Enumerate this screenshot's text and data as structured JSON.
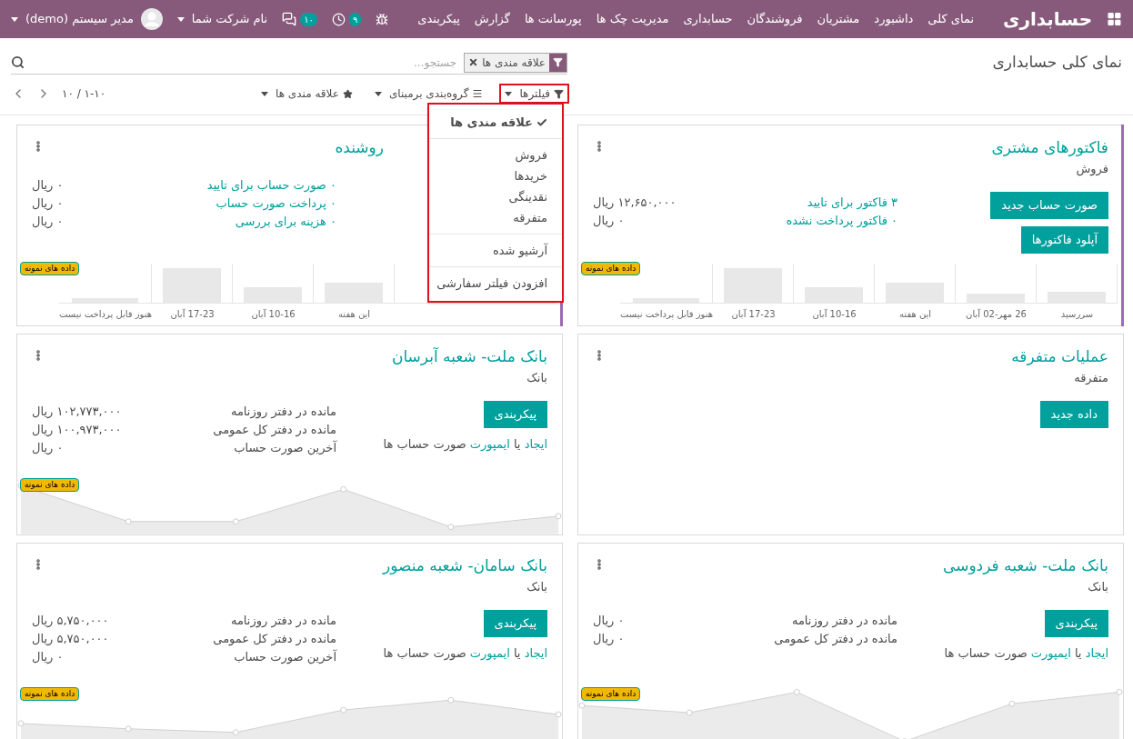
{
  "navbar": {
    "brand": "حسابداری",
    "menu": [
      "نمای کلی",
      "داشبورد",
      "مشتریان",
      "فروشندگان",
      "حسابداری",
      "مدیریت چک ها",
      "پورسانت ها",
      "گزارش",
      "پیکربندی"
    ],
    "activity_count": "۹",
    "message_count": "۱۰",
    "company": "نام شرکت شما",
    "user": "مدیر سیستم (demo)"
  },
  "control_panel": {
    "breadcrumb": "نمای کلی حسابداری",
    "search": {
      "facet": "علاقه مندی ها",
      "placeholder": "جستجو..."
    },
    "filter_buttons": [
      {
        "label": "فیلترها",
        "kind": "filter",
        "highlighted": true
      },
      {
        "label": "گروه‌بندی برمبنای",
        "kind": "group",
        "highlighted": false
      },
      {
        "label": "علاقه مندی ها",
        "kind": "favorite",
        "highlighted": false
      }
    ],
    "pager": "۱-۱۰ / ۱۰"
  },
  "filter_menu": {
    "highlighted": true,
    "groups": [
      [
        {
          "label": "علاقه مندی ها",
          "checked": true
        }
      ],
      [
        {
          "label": "فروش",
          "checked": false
        },
        {
          "label": "خریدها",
          "checked": false
        },
        {
          "label": "نقدینگی",
          "checked": false
        },
        {
          "label": "متفرقه",
          "checked": false
        }
      ],
      [
        {
          "label": "آرشیو شده",
          "checked": false
        }
      ],
      [
        {
          "label": "افزودن فیلتر سفارشی",
          "checked": false
        }
      ]
    ]
  },
  "cards": [
    {
      "title": "فاکتورهای مشتری",
      "subtitle": "فروش",
      "covered": false,
      "color": "#9b6bb5",
      "buttons": [
        "صورت حساب جدید",
        "آپلود فاکتورها"
      ],
      "stats": [
        {
          "kind": "link",
          "label": "۳ فاکتور برای تایید",
          "value": "۱۲,۶۵۰,۰۰۰ ریال"
        },
        {
          "kind": "link",
          "label": "۰ فاکتور پرداخت نشده",
          "value": "۰ ریال"
        }
      ],
      "badge": "داده های نمونه",
      "graph": {
        "kind": "bar",
        "labels": [
          "سررسید",
          "26 مهر-02 آبان",
          "این هفته",
          "10-16 آبان",
          "17-23 آبان",
          "هنوز قابل پرداخت نیست"
        ]
      }
    },
    {
      "title": "روشنده",
      "covered": true,
      "color": "#9b6bb5",
      "stats": [
        {
          "kind": "link",
          "label": "۰ صورت حساب برای تایید",
          "value": "۰ ریال"
        },
        {
          "kind": "link",
          "label": "۰ پرداخت صورت حساب",
          "value": "۰ ریال"
        },
        {
          "kind": "link",
          "label": "۰ هزینه برای بررسی",
          "value": "۰ ریال"
        }
      ],
      "badge": "داده های نمونه",
      "graph": {
        "kind": "bar",
        "labels": [
          "این هفته",
          "10-16 آبان",
          "17-23 آبان",
          "هنوز قابل پرداخت نیست"
        ]
      }
    },
    {
      "title": "عملیات متفرقه",
      "subtitle": "متفرقه",
      "covered": false,
      "buttons": [
        "داده جدید"
      ]
    },
    {
      "title": "بانک ملت- شعبه آبرسان",
      "subtitle": "بانک",
      "covered": false,
      "buttons": [
        "پیکربندی"
      ],
      "import_line": {
        "create": "ایجاد",
        "or": "یا",
        "import": "ایمپورت",
        "rest": "صورت حساب ها"
      },
      "stats": [
        {
          "kind": "plain",
          "label": "مانده در دفتر روزنامه",
          "value": "۱۰۲,۷۷۳,۰۰۰ ریال"
        },
        {
          "kind": "plain",
          "label": "مانده در دفتر کل عمومی",
          "value": "۱۰۰,۹۷۳,۰۰۰ ریال"
        },
        {
          "kind": "plain",
          "label": "آخرین صورت حساب",
          "value": "۰ ریال"
        }
      ],
      "badge": "داده های نمونه",
      "graph": {
        "kind": "line"
      }
    },
    {
      "title": "بانک ملت- شعبه فردوسی",
      "subtitle": "بانک",
      "covered": false,
      "buttons": [
        "پیکربندی"
      ],
      "import_line": {
        "create": "ایجاد",
        "or": "یا",
        "import": "ایمپورت",
        "rest": "صورت حساب ها"
      },
      "stats": [
        {
          "kind": "plain",
          "label": "مانده در دفتر روزنامه",
          "value": "۰ ریال"
        },
        {
          "kind": "plain",
          "label": "مانده در دفتر کل عمومی",
          "value": "۰ ریال"
        }
      ],
      "badge": "داده های نمونه",
      "graph": {
        "kind": "line"
      }
    },
    {
      "title": "بانک سامان- شعبه منصور",
      "subtitle": "بانک",
      "covered": false,
      "buttons": [
        "پیکربندی"
      ],
      "import_line": {
        "create": "ایجاد",
        "or": "یا",
        "import": "ایمپورت",
        "rest": "صورت حساب ها"
      },
      "stats": [
        {
          "kind": "plain",
          "label": "مانده در دفتر روزنامه",
          "value": "۵,۷۵۰,۰۰۰ ریال"
        },
        {
          "kind": "plain",
          "label": "مانده در دفتر کل عمومی",
          "value": "۵,۷۵۰,۰۰۰ ریال"
        },
        {
          "kind": "plain",
          "label": "آخرین صورت حساب",
          "value": "۰ ریال"
        }
      ],
      "badge": "داده های نمونه",
      "graph": {
        "kind": "line"
      }
    }
  ]
}
